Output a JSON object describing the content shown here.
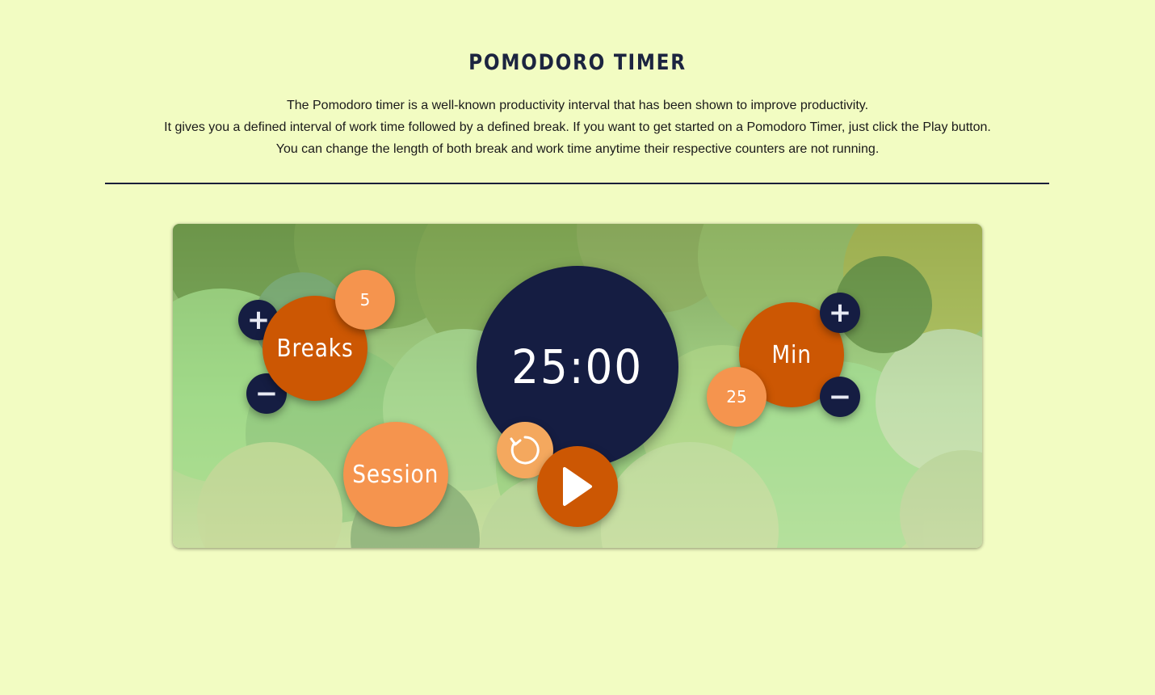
{
  "header": {
    "title": "POMODORO TIMER",
    "intro_lines": [
      "The Pomodoro timer is a well-known productivity interval that has been shown to improve productivity.",
      "It gives you a defined interval of work time followed by a defined break. If you want to get started on a Pomodoro Timer, just click the Play button.",
      "You can change the length of both break and work time anytime their respective counters are not running."
    ]
  },
  "timer": {
    "display": "25:00",
    "breaks": {
      "label": "Breaks",
      "value": "5",
      "plus": "+",
      "minus": "−"
    },
    "work": {
      "label": "Min",
      "value": "25",
      "plus": "+",
      "minus": "−"
    },
    "session_label": "Session"
  },
  "icons": {
    "reset": "reset-icon",
    "play": "play-icon",
    "plus": "plus-icon",
    "minus": "minus-icon"
  },
  "colors": {
    "page_bg": "#f2fcc2",
    "dark_navy": "#151d42",
    "burnt_orange": "#cc5703",
    "light_orange": "#f5944e"
  }
}
